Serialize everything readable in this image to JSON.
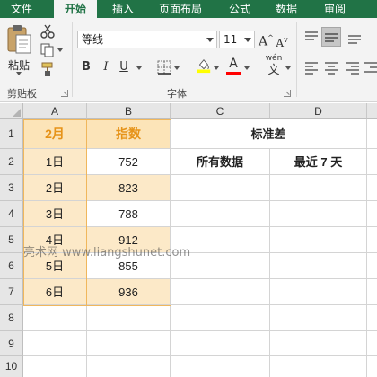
{
  "ribbon": {
    "tabs": [
      {
        "label": "文件",
        "active": false
      },
      {
        "label": "开始",
        "active": true
      },
      {
        "label": "插入",
        "active": false
      },
      {
        "label": "页面布局",
        "active": false
      },
      {
        "label": "公式",
        "active": false
      },
      {
        "label": "数据",
        "active": false
      },
      {
        "label": "审阅",
        "active": false
      }
    ],
    "clipboard": {
      "paste_label": "粘贴",
      "group_label": "剪贴板"
    },
    "font": {
      "font_name": "等线",
      "font_size": "11",
      "group_label": "字体",
      "phonetic_label": "wén",
      "fill_color": "#ffff00",
      "font_color": "#ff0000"
    },
    "colors": {
      "accent": "#217346"
    }
  },
  "sheet": {
    "columns": [
      "A",
      "B",
      "C",
      "D"
    ],
    "rows": [
      "1",
      "2",
      "3",
      "4",
      "5",
      "6",
      "7",
      "8",
      "9",
      "10"
    ],
    "cells": {
      "A1": "2月",
      "B1": "指数",
      "C1": "标准差",
      "A2": "1日",
      "B2": "752",
      "C2": "所有数据",
      "D2": "最近 7 天",
      "A3": "2日",
      "B3": "823",
      "A4": "3日",
      "B4": "788",
      "A5": "4日",
      "B5": "912",
      "A6": "5日",
      "B6": "855",
      "A7": "6日",
      "B7": "936"
    }
  },
  "watermark": "亮术网 www.liangshunet.com"
}
